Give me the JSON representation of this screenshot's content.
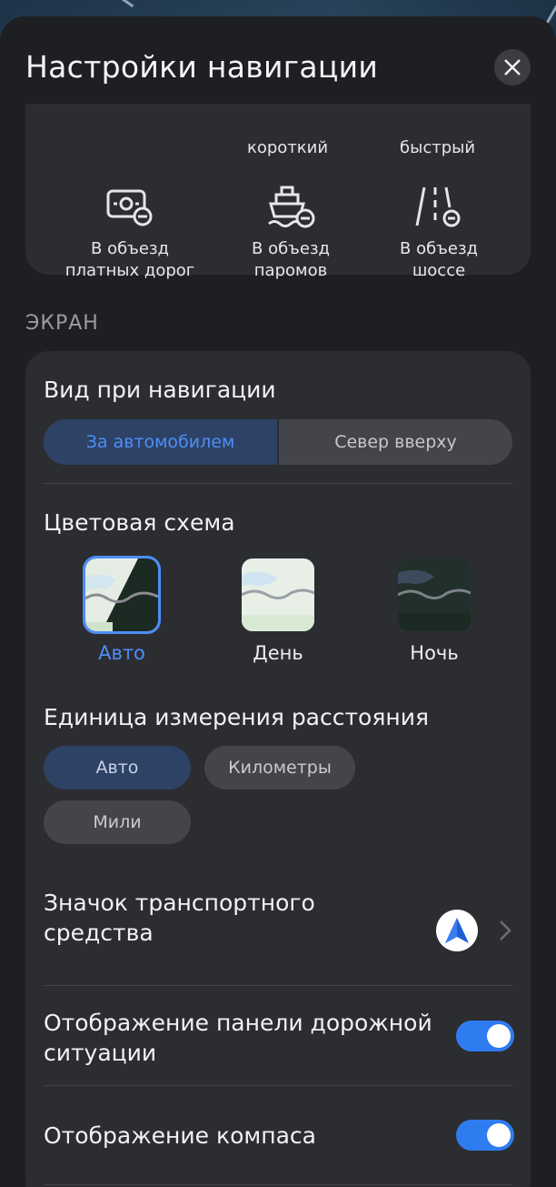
{
  "header": {
    "title": "Настройки навигации"
  },
  "avoid": {
    "cut_labels": [
      "короткий",
      "быстрый"
    ],
    "items": [
      {
        "label": "В объезд\nплатных дорог",
        "icon": "toll-road-icon"
      },
      {
        "label": "В объезд\nпаромов",
        "icon": "ferry-icon"
      },
      {
        "label": "В объезд\nшоссе",
        "icon": "highway-icon"
      }
    ]
  },
  "screen": {
    "section_label": "ЭКРАН",
    "view_heading": "Вид при навигации",
    "view_options": [
      "За автомобилем",
      "Север вверху"
    ],
    "view_selected": "За автомобилем",
    "scheme_heading": "Цветовая схема",
    "schemes": [
      {
        "label": "Авто",
        "selected": true
      },
      {
        "label": "День",
        "selected": false
      },
      {
        "label": "Ночь",
        "selected": false
      }
    ],
    "units_heading": "Единица измерения расстояния",
    "units": [
      {
        "label": "Авто",
        "selected": true
      },
      {
        "label": "Километры",
        "selected": false
      },
      {
        "label": "Мили",
        "selected": false
      }
    ],
    "vehicle_icon_label": "Значок транспортного\nсредства",
    "traffic_panel_label": "Отображение панели дорожной\nситуации",
    "traffic_panel_on": true,
    "compass_label": "Отображение компаса",
    "compass_on": true
  },
  "colors": {
    "accent": "#4d8ef7",
    "toggle_on": "#2f7cf0",
    "card_bg": "#2c2d31",
    "sheet_bg": "#1e1f22"
  }
}
